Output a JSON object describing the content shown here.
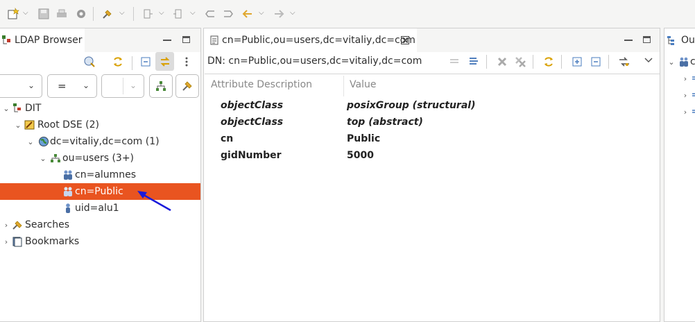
{
  "ldap_browser": {
    "tab_title": "LDAP Browser",
    "filter": {
      "attribute_value": "",
      "operator": "=",
      "value": ""
    },
    "tree": [
      {
        "label": "DIT",
        "level": 0,
        "expanded": true,
        "icon": "dit-icon"
      },
      {
        "label": "Root DSE (2)",
        "level": 1,
        "expanded": true,
        "icon": "root-dse-icon"
      },
      {
        "label": "dc=vitaliy,dc=com (1)",
        "level": 2,
        "expanded": true,
        "icon": "globe-icon"
      },
      {
        "label": "ou=users (3+)",
        "level": 3,
        "expanded": true,
        "icon": "org-unit-icon"
      },
      {
        "label": "cn=alumnes",
        "level": 4,
        "icon": "group-icon"
      },
      {
        "label": "cn=Public",
        "level": 4,
        "icon": "group-icon",
        "selected": true
      },
      {
        "label": "uid=alu1",
        "level": 4,
        "icon": "person-icon"
      },
      {
        "label": "Searches",
        "level": 0,
        "expanded": false,
        "icon": "searches-icon"
      },
      {
        "label": "Bookmarks",
        "level": 0,
        "expanded": false,
        "icon": "bookmarks-icon"
      }
    ]
  },
  "editor": {
    "tab_title": "cn=Public,ou=users,dc=vitaliy,dc=com",
    "dn_label": "DN: cn=Public,ou=users,dc=vitaliy,dc=com",
    "columns": [
      "Attribute Description",
      "Value"
    ],
    "rows": [
      {
        "attribute": "objectClass",
        "value": "posixGroup (structural)",
        "style": "obj"
      },
      {
        "attribute": "objectClass",
        "value": "top (abstract)",
        "style": "obj"
      },
      {
        "attribute": "cn",
        "value": "Public",
        "style": "bold"
      },
      {
        "attribute": "gidNumber",
        "value": "5000",
        "style": "bold"
      }
    ]
  },
  "outline": {
    "tab_title": "Ou",
    "root_label": "c"
  },
  "colors": {
    "selection": "#e95420",
    "arrow": "#1a1adb"
  }
}
